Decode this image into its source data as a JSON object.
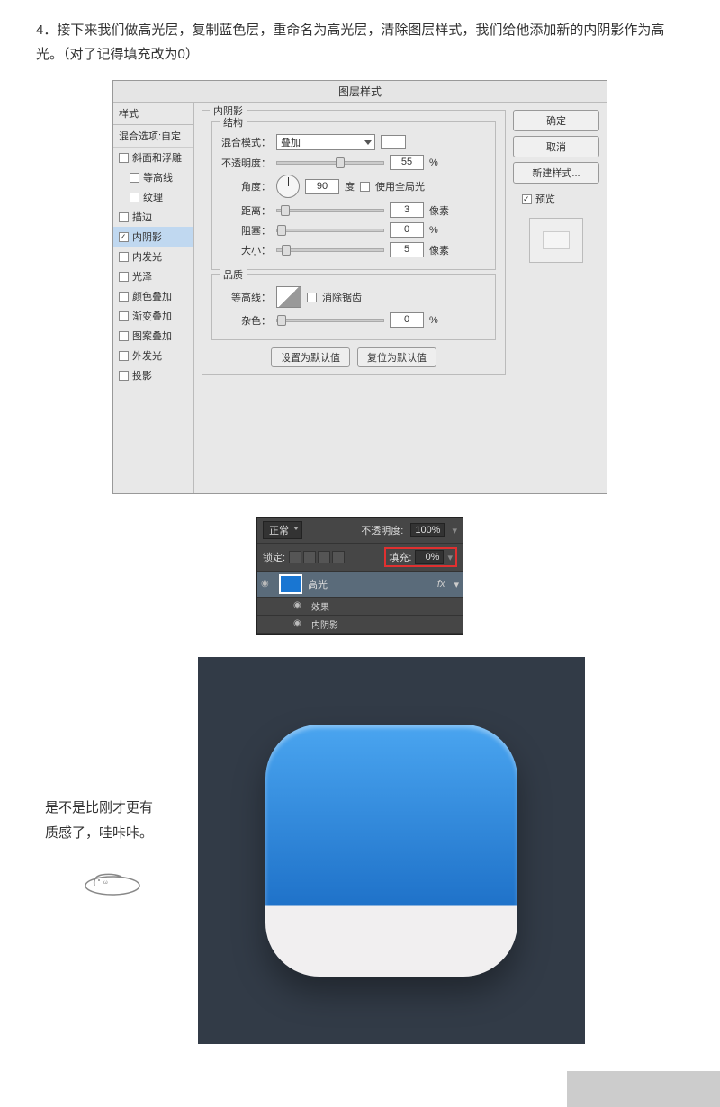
{
  "step": "4．接下来我们做高光层，复制蓝色层，重命名为高光层，清除图层样式，我们给他添加新的内阴影作为高光。（对了记得填充改为0）",
  "dialog": {
    "title": "图层样式",
    "sidebar": {
      "header": "样式",
      "sub": "混合选项:自定",
      "items": [
        "斜面和浮雕",
        "等高线",
        "纹理",
        "描边",
        "内阴影",
        "内发光",
        "光泽",
        "颜色叠加",
        "渐变叠加",
        "图案叠加",
        "外发光",
        "投影"
      ]
    },
    "panel": {
      "section": "内阴影",
      "group1": "结构",
      "blend_label": "混合模式：",
      "blend_value": "叠加",
      "opacity_label": "不透明度：",
      "opacity_value": "55",
      "pct": "%",
      "angle_label": "角度：",
      "angle_value": "90",
      "angle_unit": "度",
      "global": "使用全局光",
      "distance_label": "距离：",
      "distance_value": "3",
      "px": "像素",
      "choke_label": "阻塞：",
      "choke_value": "0",
      "size_label": "大小：",
      "size_value": "5",
      "group2": "品质",
      "contour_label": "等高线：",
      "anti": "消除锯齿",
      "noise_label": "杂色：",
      "noise_value": "0",
      "btn_default": "设置为默认值",
      "btn_reset": "复位为默认值"
    },
    "right": {
      "ok": "确定",
      "cancel": "取消",
      "new": "新建样式...",
      "preview": "预览"
    }
  },
  "layers": {
    "mode": "正常",
    "opacity_label": "不透明度:",
    "opacity_value": "100%",
    "lock_label": "锁定:",
    "fill_label": "填充:",
    "fill_value": "0%",
    "layer_name": "高光",
    "fx": "fx",
    "effects": "效果",
    "inner_shadow": "内阴影"
  },
  "result": {
    "line1": "是不是比刚才更有",
    "line2": "质感了，哇咔咔。"
  }
}
